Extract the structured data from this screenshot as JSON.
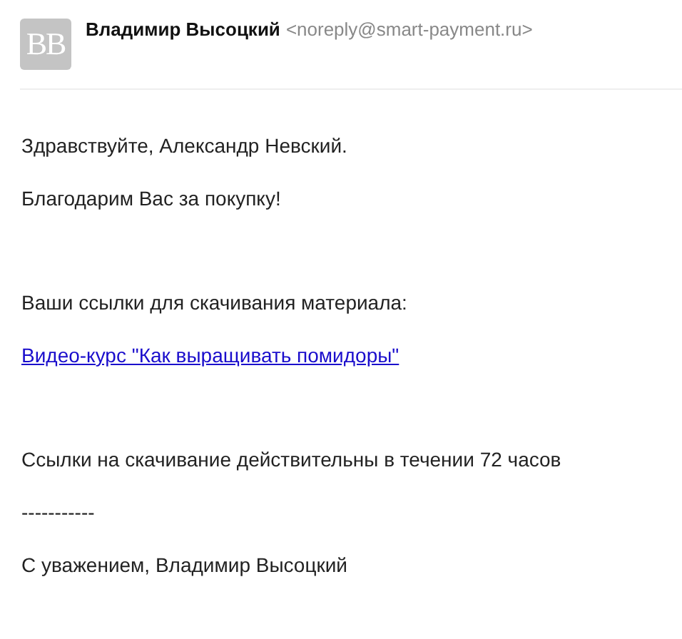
{
  "sender": {
    "avatar": "ВВ",
    "name": "Владимир Высоцкий",
    "email": "<noreply@smart-payment.ru>"
  },
  "body": [
    {
      "kind": "text",
      "text": "Здравствуйте, Александр Невский."
    },
    {
      "kind": "text",
      "text": "Благодарим Вас за покупку!"
    },
    {
      "kind": "spacer"
    },
    {
      "kind": "text",
      "text": "Ваши ссылки для скачивания материала:"
    },
    {
      "kind": "link",
      "text": "Видео-курс \"Как выращивать помидоры\""
    },
    {
      "kind": "spacer"
    },
    {
      "kind": "text",
      "text": "Ссылки на скачивание действительны в течении 72 часов"
    },
    {
      "kind": "text",
      "text": "-----------"
    },
    {
      "kind": "text",
      "text": "С уважением, Владимир Высоцкий"
    }
  ]
}
